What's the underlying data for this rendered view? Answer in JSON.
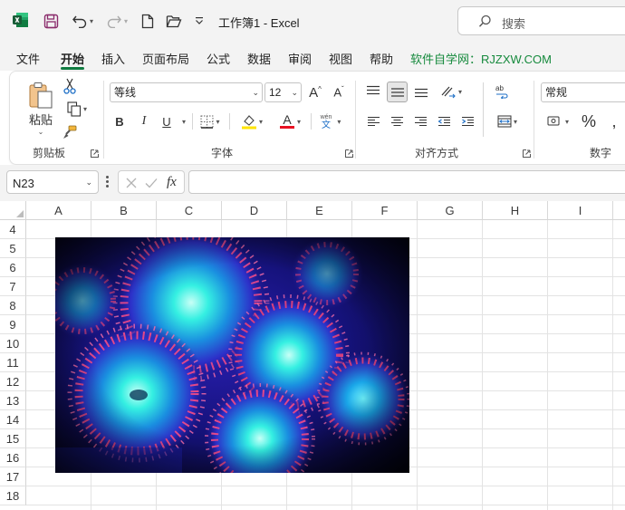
{
  "titlebar": {
    "title": "工作簿1  -  Excel",
    "search_placeholder": "搜索",
    "icons": [
      "excel-logo",
      "save-icon",
      "undo-icon",
      "redo-icon",
      "new-file-icon",
      "open-folder-icon",
      "customize-qat-icon",
      "search-icon"
    ]
  },
  "tabs": [
    {
      "label": "文件"
    },
    {
      "label": "开始",
      "active": true
    },
    {
      "label": "插入"
    },
    {
      "label": "页面布局"
    },
    {
      "label": "公式"
    },
    {
      "label": "数据"
    },
    {
      "label": "审阅"
    },
    {
      "label": "视图"
    },
    {
      "label": "帮助"
    },
    {
      "label": "软件自学网：RJZXW.COM"
    }
  ],
  "ribbon": {
    "clipboard": {
      "label": "剪贴板",
      "paste_label": "粘贴"
    },
    "font": {
      "label": "字体",
      "font_name": "等线",
      "font_size": "12",
      "bold": "B",
      "italic": "I",
      "underline": "U",
      "font_color_letter": "A",
      "phonetic_top": "wén",
      "phonetic_bottom": "文"
    },
    "alignment": {
      "label": "对齐方式"
    },
    "number": {
      "label": "数字",
      "format": "常规",
      "percent": "%"
    }
  },
  "formula_bar": {
    "name_box": "N23",
    "fx": "fx",
    "formula": ""
  },
  "grid": {
    "columns": [
      "A",
      "B",
      "C",
      "D",
      "E",
      "F",
      "G",
      "H",
      "I"
    ],
    "rows": [
      "4",
      "5",
      "6",
      "7",
      "8",
      "9",
      "10",
      "11",
      "12",
      "13",
      "14",
      "15",
      "16",
      "17",
      "18"
    ]
  },
  "picture": {
    "subject": "zoanthid coral polyps, glowing cyan centers with magenta tentacle rings"
  },
  "colors": {
    "accent": "#107c41",
    "brand_text": "#168a3d",
    "bg": "#f3f3f3",
    "highlight_yellow": "#ffe400",
    "font_red": "#e81123"
  }
}
